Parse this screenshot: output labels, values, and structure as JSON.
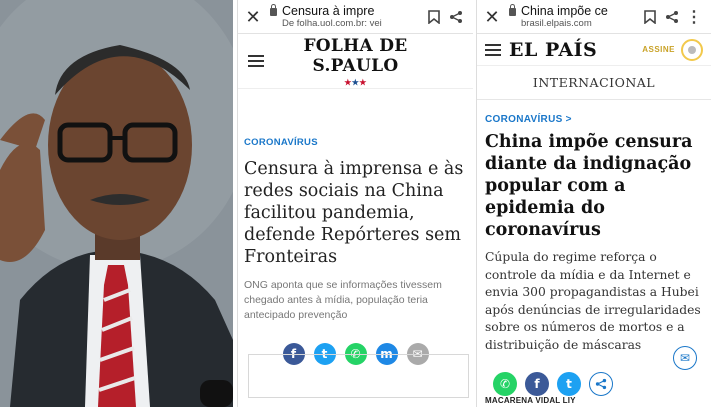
{
  "folha": {
    "tab_title": "Censura à impre",
    "domain": "De folha.uol.com.br: vei",
    "logo": "FOLHA DE S.PAULO",
    "stars": "★★★",
    "kicker": "CORONAVÍRUS",
    "headline": "Censura à imprensa e às redes sociais na China facilitou pandemia, defende Repórteres sem Fronteiras",
    "subheadline": "ONG aponta que se informações tivessem chegado antes à mídia, população teria antecipado prevenção",
    "share_icons": [
      "facebook-icon",
      "twitter-icon",
      "whatsapp-icon",
      "messenger-icon",
      "email-icon"
    ]
  },
  "elpais": {
    "tab_title": "China impõe ce",
    "domain": "brasil.elpais.com",
    "logo": "EL PAÍS",
    "assine": "ASSINE",
    "section": "INTERNACIONAL",
    "kicker": "CORONAVÍRUS >",
    "headline": "China impõe censura diante da indignação popular com a epidemia do coronavírus",
    "subheadline": "Cúpula do regime reforça o controle da mídia e da Internet e envia 300 propagandistas a Hubei após denúncias de irregularidades sobre os números de mortos e a distribuição de máscaras",
    "share_icons": [
      "whatsapp-icon",
      "facebook-icon",
      "twitter-icon",
      "share-icon",
      "email-icon"
    ],
    "byline": "MACARENA VIDAL LIY"
  },
  "colors": {
    "link_blue": "#1a77c9",
    "facebook": "#3b5998",
    "twitter": "#1da1f2",
    "whatsapp": "#25d366",
    "assine_gold": "#c9a227"
  }
}
